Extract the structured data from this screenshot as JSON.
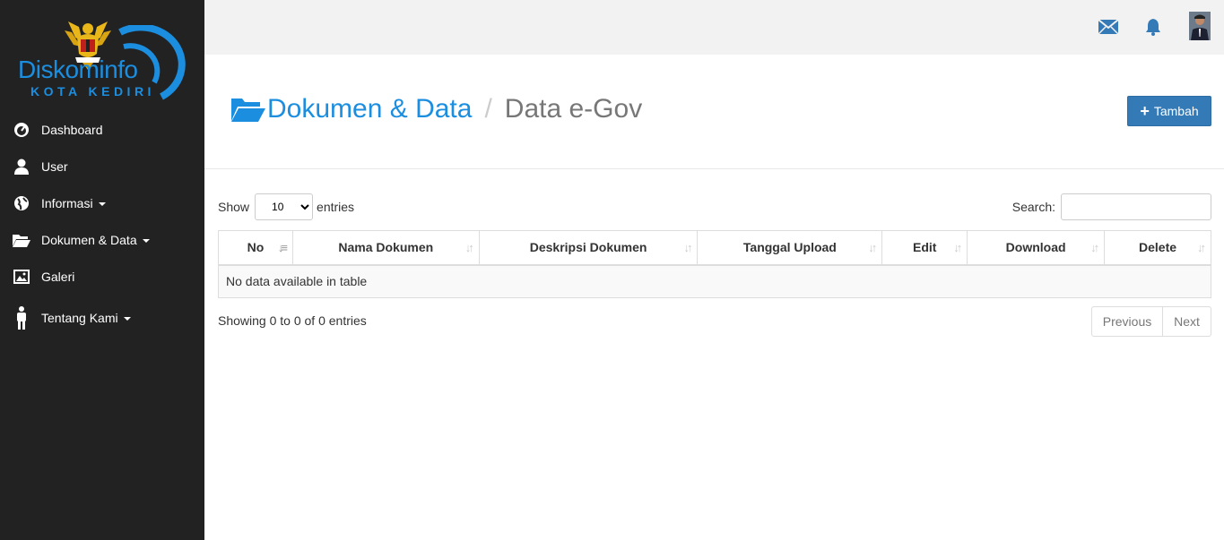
{
  "logo": {
    "brand_left": "Diskom",
    "brand_right": "info",
    "city": "KOTA KEDIRI"
  },
  "sidebar": {
    "items": [
      {
        "label": "Dashboard",
        "icon": "dashboard-icon"
      },
      {
        "label": "User",
        "icon": "user-icon"
      },
      {
        "label": "Informasi",
        "icon": "globe-icon",
        "dropdown": true
      },
      {
        "label": "Dokumen & Data",
        "icon": "folder-open-icon",
        "dropdown": true
      },
      {
        "label": "Galeri",
        "icon": "picture-icon"
      },
      {
        "label": "Tentang Kami",
        "icon": "person-icon",
        "dropdown": true
      }
    ]
  },
  "topbar": {
    "icons": [
      "mail-icon",
      "bell-icon",
      "avatar"
    ]
  },
  "header": {
    "breadcrumb_parent": "Dokumen & Data",
    "breadcrumb_separator": "/",
    "breadcrumb_current": "Data e-Gov",
    "add_button": "Tambah"
  },
  "table_controls": {
    "show_label": "Show",
    "entries_value": "10",
    "entries_label": "entries",
    "search_label": "Search:",
    "search_value": ""
  },
  "table": {
    "columns": [
      "No",
      "Nama Dokumen",
      "Deskripsi Dokumen",
      "Tanggal Upload",
      "Edit",
      "Download",
      "Delete"
    ],
    "empty_message": "No data available in table"
  },
  "footer": {
    "info": "Showing 0 to 0 of 0 entries",
    "prev": "Previous",
    "next": "Next"
  },
  "colors": {
    "sidebar": "#222222",
    "accent": "#1c8ee0",
    "button": "#337ab7",
    "topbar": "#f2f2f2"
  }
}
